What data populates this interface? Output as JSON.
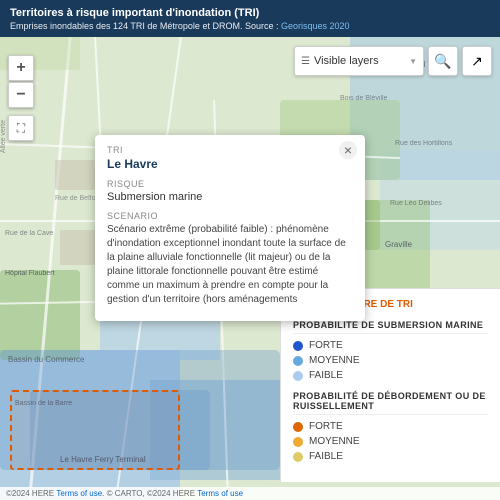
{
  "header": {
    "title": "Territoires à risque important d'inondation (TRI)",
    "subtitle": "Emprises inondables des 124 TRI de Métropole et DROM. Source : ",
    "source_link_text": "Georisques 2020",
    "source_link": "#"
  },
  "toolbar": {
    "layers_label": "Visible layers",
    "search_icon": "🔍",
    "share_icon": "↗"
  },
  "zoom_controls": {
    "zoom_in": "+",
    "zoom_out": "−",
    "fullscreen": "⛶"
  },
  "info_card": {
    "tri_label": "TRI",
    "tri_value": "Le Havre",
    "risque_label": "RISQUE",
    "risque_value": "Submersion marine",
    "scenario_label": "SCENARIO",
    "scenario_value": "Scénario extrême (probabilité faible) : phénomène d'inondation exceptionnel inondant toute la surface de la plaine alluviale fonctionnelle (lit majeur) ou de la plaine littorale fonctionnelle pouvant être estimé comme un maximum à prendre en compte pour la gestion d'un territoire (hors aménagements",
    "close_icon": "×"
  },
  "legend": {
    "perimeter_label": "PÉRIMÈTRE DE TRI",
    "submersion_title": "PROBABILITÉ DE SUBMERSION MARINE",
    "submersion_items": [
      {
        "label": "FORTE",
        "color": "#2255cc"
      },
      {
        "label": "MOYENNE",
        "color": "#66aadd"
      },
      {
        "label": "FAIBLE",
        "color": "#aaccee"
      }
    ],
    "debordement_title": "PROBABILITÉ DE DÉBORDEMENT OU DE RUISSELLEMENT",
    "debordement_items": [
      {
        "label": "FORTE",
        "color": "#dd6600"
      },
      {
        "label": "MOYENNE",
        "color": "#eeaa33"
      },
      {
        "label": "FAIBLE",
        "color": "#ddcc66"
      }
    ]
  },
  "copyright": {
    "text": "©2024 HERE",
    "terms_text": "Terms of use",
    "separator": ". © CARTO, ©2024 HERE",
    "terms_text2": "Terms of use"
  }
}
